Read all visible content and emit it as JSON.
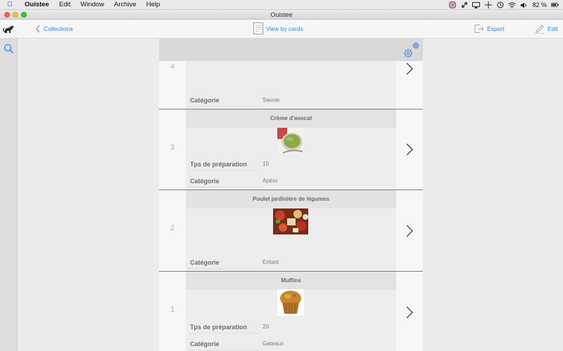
{
  "menubar": {
    "app_name": "Ouistee",
    "items": [
      "Edit",
      "Window",
      "Archive",
      "Help"
    ],
    "battery": "82 %"
  },
  "window": {
    "title": "Ouistee"
  },
  "toolbar": {
    "back_label": "Collections",
    "view_label": "View by cards",
    "export_label": "Export",
    "edit_label": "Edit"
  },
  "colors": {
    "accent": "#3a82d8"
  },
  "records": [
    {
      "index": "4",
      "title": "",
      "field_label": "Catégorie",
      "field_value": "Savoie"
    },
    {
      "index": "3",
      "title": "Crème d'avocat",
      "prep_label": "Tps de préparation",
      "prep_value": "10",
      "field_label": "Catégorie",
      "field_value": "Apéro"
    },
    {
      "index": "2",
      "title": "Poulet jardinière de légumes",
      "field_label": "Catégorie",
      "field_value": "Enfant"
    },
    {
      "index": "1",
      "title": "Muffins",
      "prep_label": "Tps de préparation",
      "prep_value": "20",
      "field_label": "Catégorie",
      "field_value": "Gateaux"
    }
  ]
}
